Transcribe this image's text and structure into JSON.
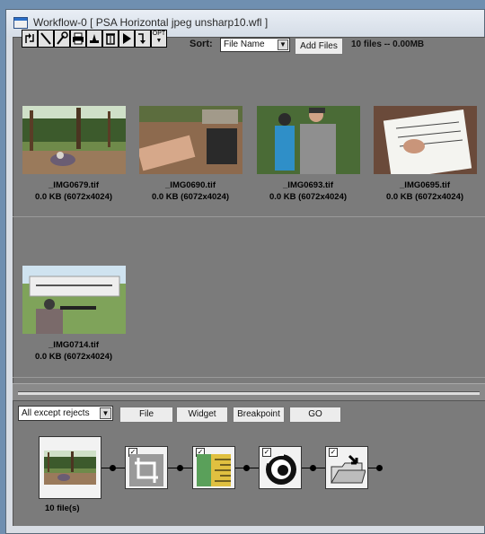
{
  "window": {
    "title": "Workflow-0 [ PSA Horizontal jpeg unsharp10.wfl ]"
  },
  "toolbar": {
    "tools": [
      {
        "icon": "refresh-arrows-icon"
      },
      {
        "icon": "wand-icon"
      },
      {
        "icon": "tools-icon"
      },
      {
        "icon": "print-icon"
      },
      {
        "icon": "stamp-icon"
      },
      {
        "icon": "trash-icon"
      },
      {
        "icon": "play-icon"
      },
      {
        "icon": "step-icon"
      },
      {
        "icon": "opt-icon",
        "label": "OPT"
      }
    ],
    "sort_label": "Sort:",
    "sort_value": "File Name",
    "add_files_label": "Add Files",
    "summary": "10 files -- 0.00MB"
  },
  "thumbnails": [
    {
      "name": "_IMG0679.tif",
      "info": "0.0 KB (6072x4024)"
    },
    {
      "name": "_IMG0690.tif",
      "info": "0.0 KB (6072x4024)"
    },
    {
      "name": "_IMG0693.tif",
      "info": "0.0 KB (6072x4024)"
    },
    {
      "name": "_IMG0695.tif",
      "info": "0.0 KB (6072x4024)"
    },
    {
      "name": "_IMG0714.tif",
      "info": "0.0 KB (6072x4024)"
    }
  ],
  "workflow": {
    "filter_value": "All except rejects",
    "buttons": [
      "File",
      "Widget",
      "Breakpoint",
      "GO"
    ],
    "file_count": "10 file(s)",
    "nodes": [
      "crop-icon",
      "ruler-icon",
      "lens-icon",
      "save-folder-icon"
    ]
  },
  "colors": {
    "panel": "#7b7b7b",
    "title_accent": "#2b6fc8"
  }
}
